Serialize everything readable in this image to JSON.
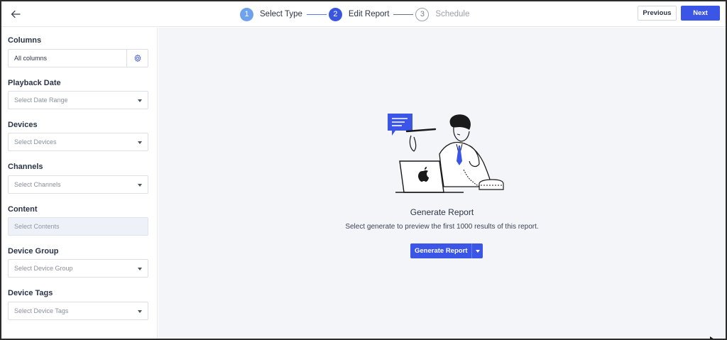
{
  "header": {
    "steps": [
      {
        "number": "1",
        "label": "Select Type"
      },
      {
        "number": "2",
        "label": "Edit Report"
      },
      {
        "number": "3",
        "label": "Schedule"
      }
    ],
    "previous_label": "Previous",
    "next_label": "Next"
  },
  "sidebar": {
    "columns": {
      "title": "Columns",
      "value": "All columns"
    },
    "fields": [
      {
        "title": "Playback Date",
        "placeholder": "Select Date Range"
      },
      {
        "title": "Devices",
        "placeholder": "Select Devices"
      },
      {
        "title": "Channels",
        "placeholder": "Select Channels"
      },
      {
        "title": "Content",
        "placeholder": "Select Contents"
      },
      {
        "title": "Device Group",
        "placeholder": "Select Device Group"
      },
      {
        "title": "Device Tags",
        "placeholder": "Select Device Tags"
      }
    ]
  },
  "main": {
    "title": "Generate Report",
    "subtitle": "Select generate to preview the first 1000 results of this report.",
    "generate_label": "Generate Report"
  },
  "colors": {
    "accent": "#3b55e6",
    "step_done": "#6ea2ee",
    "main_bg": "#f3f5f9"
  }
}
